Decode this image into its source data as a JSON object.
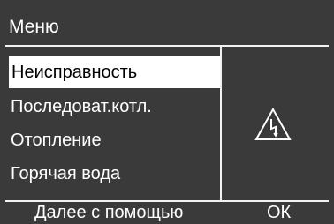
{
  "header": {
    "title": "Меню"
  },
  "menu": {
    "items": [
      {
        "label": "Неисправность",
        "selected": true
      },
      {
        "label": "Последоват.котл.",
        "selected": false
      },
      {
        "label": "Отопление",
        "selected": false
      },
      {
        "label": "Горячая вода",
        "selected": false
      }
    ]
  },
  "status": {
    "icon": "warning-electric-icon"
  },
  "footer": {
    "hint": "Далее с помощью",
    "ok_label": "ОК"
  },
  "colors": {
    "background": "#3a3a3a",
    "foreground": "#ffffff",
    "selection_background": "#ffffff",
    "selection_text": "#000000"
  }
}
